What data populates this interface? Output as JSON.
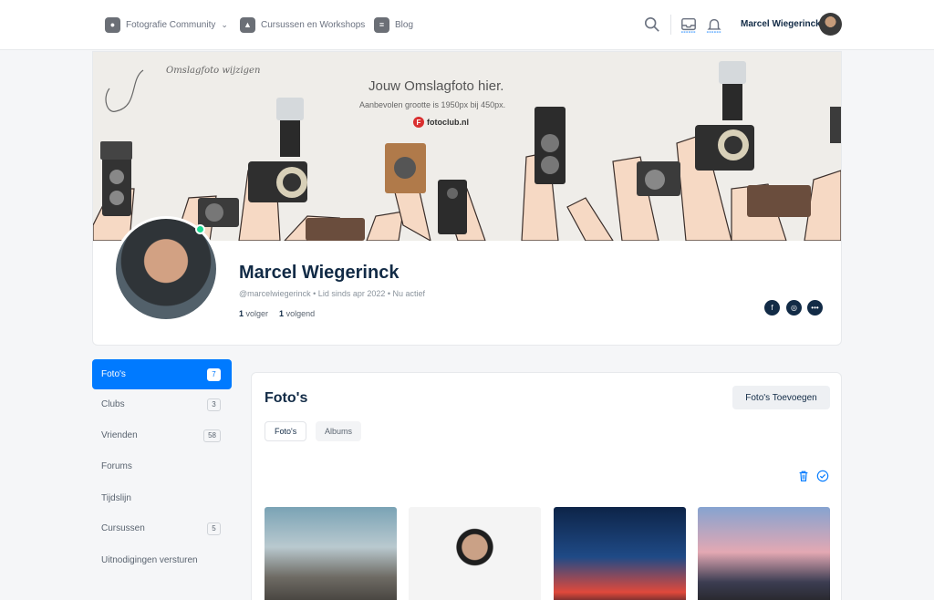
{
  "nav": {
    "items": [
      {
        "label": "Fotografie Community",
        "icon": "camera-app-icon"
      },
      {
        "label": "Cursussen en Workshops",
        "icon": "graduation-cap-icon"
      },
      {
        "label": "Blog",
        "icon": "blog-icon"
      }
    ],
    "user_name": "Marcel Wiegerinck"
  },
  "cover": {
    "title": "Jouw Omslagfoto hier.",
    "subtitle": "Aanbevolen grootte is 1950px bij 450px.",
    "logo_text": "fotoclub.nl",
    "logo_letter": "F",
    "hint": "Omslagfoto wijzigen"
  },
  "profile": {
    "name": "Marcel Wiegerinck",
    "meta": "@marcelwiegerinck • Lid sinds apr 2022 • Nu actief",
    "followers_count": "1",
    "followers_label": "volger",
    "following_count": "1",
    "following_label": "volgend"
  },
  "sidebar": {
    "items": [
      {
        "label": "Foto's",
        "count": "7"
      },
      {
        "label": "Clubs",
        "count": "3"
      },
      {
        "label": "Vrienden",
        "count": "58"
      },
      {
        "label": "Forums",
        "count": ""
      },
      {
        "label": "Tijdslijn",
        "count": ""
      },
      {
        "label": "Cursussen",
        "count": "5"
      },
      {
        "label": "Uitnodigingen versturen",
        "count": ""
      }
    ]
  },
  "main": {
    "title": "Foto's",
    "add_button": "Foto's Toevoegen",
    "tabs": [
      "Foto's",
      "Albums"
    ]
  },
  "colors": {
    "accent": "#007aff",
    "heading": "#122b46",
    "online": "#1cd991"
  }
}
